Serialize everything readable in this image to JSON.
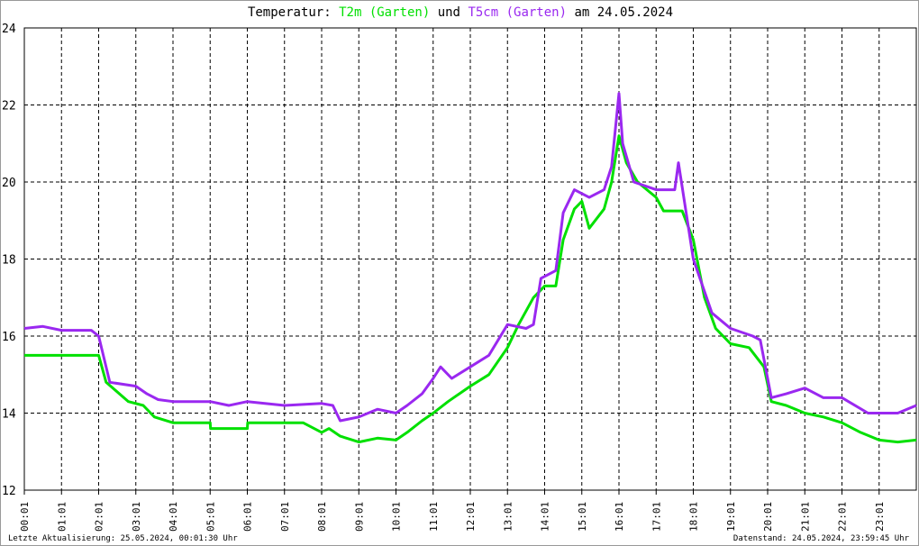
{
  "title": {
    "prefix": "Temperatur:",
    "s1": "T2m (Garten)",
    "mid": "und",
    "s2": "T5cm (Garten)",
    "suffix": "am 24.05.2024"
  },
  "footer": {
    "left": "Letzte Aktualisierung: 25.05.2024, 00:01:30 Uhr",
    "right": "Datenstand: 24.05.2024, 23:59:45 Uhr"
  },
  "chart_data": {
    "type": "line",
    "title": "Temperatur: T2m (Garten) und T5cm (Garten) am 24.05.2024",
    "xlabel": "",
    "ylabel": "",
    "xlim": [
      0,
      24
    ],
    "ylim": [
      12,
      24
    ],
    "yticks": [
      12,
      14,
      16,
      18,
      20,
      22,
      24
    ],
    "xtick_labels": [
      "00:01",
      "01:01",
      "02:01",
      "03:01",
      "04:01",
      "05:01",
      "06:01",
      "07:01",
      "08:01",
      "09:01",
      "10:01",
      "11:01",
      "12:01",
      "13:01",
      "14:01",
      "15:01",
      "16:01",
      "17:01",
      "18:01",
      "19:01",
      "20:01",
      "21:01",
      "22:01",
      "23:01"
    ],
    "grid": true,
    "series": [
      {
        "name": "T2m (Garten)",
        "color": "#00e000",
        "x": [
          0,
          1,
          2.0,
          2.2,
          2.8,
          3.2,
          3.5,
          4.0,
          5.0,
          5.01,
          6.0,
          6.01,
          7.5,
          8.0,
          8.2,
          8.5,
          9.0,
          9.5,
          10.0,
          10.3,
          10.7,
          11.0,
          11.4,
          12.0,
          12.5,
          13.0,
          13.3,
          13.7,
          14.0,
          14.3,
          14.5,
          14.8,
          15.0,
          15.2,
          15.6,
          15.8,
          16.0,
          16.2,
          16.5,
          17.0,
          17.2,
          17.7,
          18.0,
          18.3,
          18.6,
          19.0,
          19.5,
          19.9,
          20.1,
          20.5,
          21.0,
          21.5,
          22.0,
          22.5,
          23.0,
          23.5,
          24
        ],
        "y": [
          15.5,
          15.5,
          15.5,
          14.8,
          14.3,
          14.2,
          13.9,
          13.75,
          13.75,
          13.6,
          13.6,
          13.75,
          13.75,
          13.5,
          13.6,
          13.4,
          13.25,
          13.35,
          13.3,
          13.5,
          13.8,
          14.0,
          14.3,
          14.7,
          15.0,
          15.7,
          16.3,
          17.0,
          17.3,
          17.3,
          18.5,
          19.3,
          19.5,
          18.8,
          19.3,
          20.0,
          21.2,
          20.5,
          20.0,
          19.6,
          19.25,
          19.25,
          18.5,
          17.0,
          16.2,
          15.8,
          15.7,
          15.2,
          14.3,
          14.2,
          14.0,
          13.9,
          13.75,
          13.5,
          13.3,
          13.25,
          13.3
        ]
      },
      {
        "name": "T5cm (Garten)",
        "color": "#9a28f0",
        "x": [
          0,
          0.5,
          1.0,
          1.8,
          2.0,
          2.3,
          3.0,
          3.3,
          3.6,
          4.0,
          5.0,
          5.5,
          6.0,
          7.0,
          8.0,
          8.3,
          8.5,
          9.0,
          9.5,
          10.0,
          10.3,
          10.7,
          11.0,
          11.2,
          11.5,
          12.0,
          12.5,
          13.0,
          13.5,
          13.7,
          13.9,
          14.3,
          14.5,
          14.8,
          15.2,
          15.6,
          15.8,
          16.0,
          16.1,
          16.4,
          17.0,
          17.5,
          17.6,
          18.0,
          18.5,
          19.0,
          19.6,
          19.8,
          20.1,
          20.5,
          21.0,
          21.5,
          22.0,
          22.7,
          23.5,
          24
        ],
        "y": [
          16.2,
          16.25,
          16.15,
          16.15,
          16.0,
          14.8,
          14.7,
          14.5,
          14.35,
          14.3,
          14.3,
          14.2,
          14.3,
          14.2,
          14.25,
          14.2,
          13.8,
          13.9,
          14.1,
          14.0,
          14.2,
          14.5,
          14.9,
          15.2,
          14.9,
          15.2,
          15.5,
          16.3,
          16.2,
          16.3,
          17.5,
          17.7,
          19.2,
          19.8,
          19.6,
          19.8,
          20.4,
          22.3,
          21.0,
          20.0,
          19.8,
          19.8,
          20.5,
          18.0,
          16.6,
          16.2,
          16.0,
          15.9,
          14.4,
          14.5,
          14.65,
          14.4,
          14.4,
          14.0,
          14.0,
          14.2
        ]
      }
    ]
  }
}
